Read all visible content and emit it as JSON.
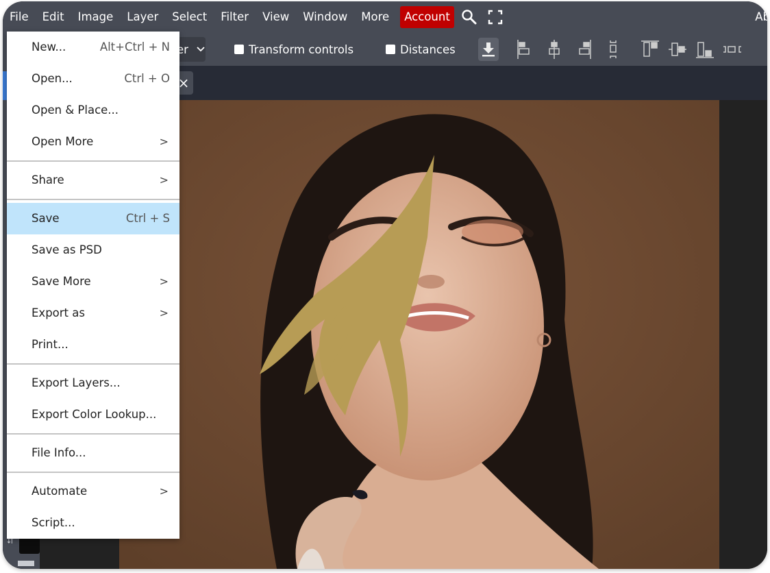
{
  "app": {
    "menubar": {
      "items": [
        "File",
        "Edit",
        "Image",
        "Layer",
        "Select",
        "Filter",
        "View",
        "Window",
        "More"
      ],
      "account_label": "Account",
      "search_icon": "search-icon",
      "fullscreen_icon": "fullscreen-icon",
      "right_label": "Ab"
    },
    "toolbar": {
      "dropdown_value": "er",
      "dropdown_chevron": "⌄",
      "transform_controls_label": "Transform controls",
      "transform_controls_checked": false,
      "distances_label": "Distances",
      "distances_checked": false,
      "icons": [
        "download-icon",
        "align-left-icon",
        "align-center-h-icon",
        "align-right-icon",
        "distribute-v-icon",
        "align-top-icon",
        "align-middle-v-icon",
        "align-bottom-icon",
        "distribute-h-icon"
      ]
    },
    "tab": {
      "close_glyph": "×"
    },
    "colors": {
      "menubar_bg": "#474b55",
      "account_bg": "#c00000",
      "highlight": "#c0e4fb",
      "accent": "#3a7bd5",
      "canvas_bg": "#222222",
      "photo_bg": "#6e4a30"
    }
  },
  "file_menu": {
    "groups": [
      [
        {
          "label": "New...",
          "shortcut": "Alt+Ctrl + N"
        },
        {
          "label": "Open...",
          "shortcut": "Ctrl + O"
        },
        {
          "label": "Open & Place..."
        },
        {
          "label": "Open More",
          "submenu": true
        }
      ],
      [
        {
          "label": "Share",
          "submenu": true
        }
      ],
      [
        {
          "label": "Save",
          "shortcut": "Ctrl + S",
          "highlighted": true
        },
        {
          "label": "Save as PSD"
        },
        {
          "label": "Save More",
          "submenu": true
        },
        {
          "label": "Export as",
          "submenu": true
        },
        {
          "label": "Print..."
        }
      ],
      [
        {
          "label": "Export Layers..."
        },
        {
          "label": "Export Color Lookup..."
        }
      ],
      [
        {
          "label": "File Info..."
        }
      ],
      [
        {
          "label": "Automate",
          "submenu": true
        },
        {
          "label": "Script..."
        }
      ]
    ],
    "submenu_glyph": ">"
  },
  "canvas": {
    "image_description": "portrait of woman with closed eyes holding golden fern against brown background"
  }
}
